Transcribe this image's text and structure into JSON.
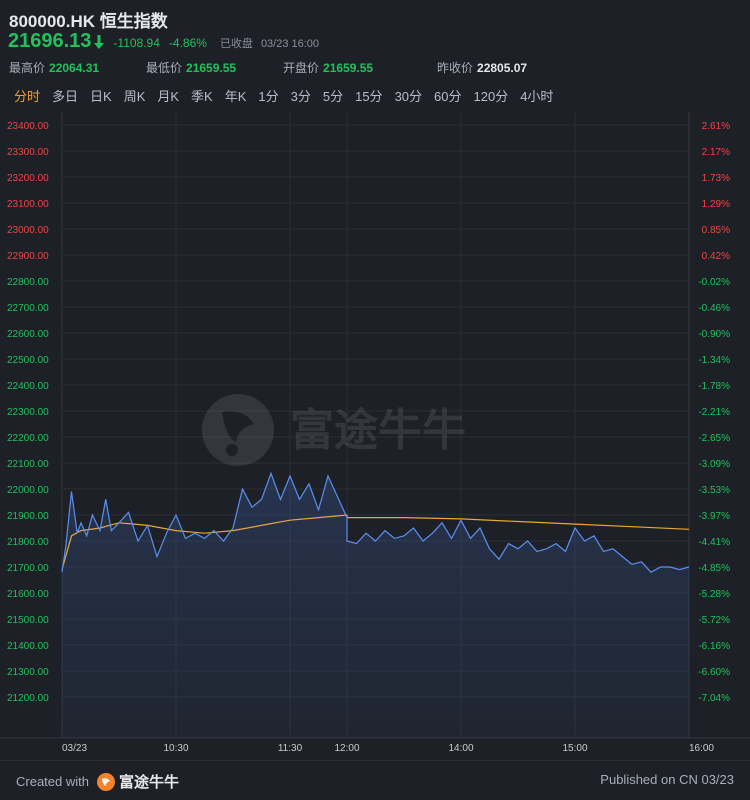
{
  "header": {
    "title": "800000.HK 恒生指数",
    "price": "21696.13",
    "change": "-1108.94",
    "change_pct": "-4.86%",
    "status": "已收盘",
    "timestamp": "03/23 16:00",
    "arrow_icon": "arrow-down-icon",
    "up_color": "#f04545",
    "down_color": "#21c25b"
  },
  "stats": [
    {
      "label": "最高价",
      "value": "22064.31"
    },
    {
      "label": "最低价",
      "value": "21659.55"
    },
    {
      "label": "开盘价",
      "value": "21659.55"
    },
    {
      "label": "昨收价",
      "value": "22805.07"
    }
  ],
  "tabs": [
    "分时",
    "多日",
    "日K",
    "周K",
    "月K",
    "季K",
    "年K",
    "1分",
    "3分",
    "5分",
    "15分",
    "30分",
    "60分",
    "120分",
    "4小时"
  ],
  "active_tab": "分时",
  "watermark": "富途牛牛",
  "footer": {
    "created_prefix": "Created with",
    "brand": "富途牛牛",
    "published": "Published on CN 03/23"
  },
  "chart_data": {
    "type": "line",
    "ylim": [
      21100,
      23450
    ],
    "prev_close": 22805.07,
    "y_ticks": [
      "23400.00",
      "23300.00",
      "23200.00",
      "23100.00",
      "23000.00",
      "22900.00",
      "22800.00",
      "22700.00",
      "22600.00",
      "22500.00",
      "22400.00",
      "22300.00",
      "22200.00",
      "22100.00",
      "22000.00",
      "21900.00",
      "21800.00",
      "21700.00",
      "21600.00",
      "21500.00",
      "21400.00",
      "21300.00",
      "21200.00"
    ],
    "y_tick_values": [
      23400,
      23300,
      23200,
      23100,
      23000,
      22900,
      22800,
      22700,
      22600,
      22500,
      22400,
      22300,
      22200,
      22100,
      22000,
      21900,
      21800,
      21700,
      21600,
      21500,
      21400,
      21300,
      21200
    ],
    "pct_ticks": [
      "2.61%",
      "2.17%",
      "1.73%",
      "1.29%",
      "0.85%",
      "0.42%",
      "-0.02%",
      "-0.46%",
      "-0.90%",
      "-1.34%",
      "-1.78%",
      "-2.21%",
      "-2.65%",
      "-3.09%",
      "-3.53%",
      "-3.97%",
      "-4.41%",
      "-4.85%",
      "-5.28%",
      "-5.72%",
      "-6.16%",
      "-6.60%",
      "-7.04%"
    ],
    "x_ticks": [
      {
        "label": "03/23",
        "x": "09:30"
      },
      {
        "label": "10:30",
        "x": "10:30"
      },
      {
        "label": "11:30",
        "x": "11:30"
      },
      {
        "label": "12:00",
        "x": "13:00"
      },
      {
        "label": "14:00",
        "x": "14:00"
      },
      {
        "label": "15:00",
        "x": "15:00"
      },
      {
        "label": "16:00",
        "x": "16:00"
      }
    ],
    "series": [
      {
        "name": "",
        "color": "#5b8ff0",
        "x": [
          "09:30",
          "09:32",
          "09:35",
          "09:38",
          "09:40",
          "09:43",
          "09:46",
          "09:50",
          "09:53",
          "09:56",
          "10:00",
          "10:05",
          "10:10",
          "10:15",
          "10:20",
          "10:25",
          "10:30",
          "10:35",
          "10:40",
          "10:45",
          "10:50",
          "10:55",
          "11:00",
          "11:05",
          "11:10",
          "11:15",
          "11:20",
          "11:25",
          "11:30",
          "11:35",
          "11:40",
          "11:45",
          "11:50",
          "11:55",
          "12:00",
          "13:00",
          "13:05",
          "13:10",
          "13:15",
          "13:20",
          "13:25",
          "13:30",
          "13:35",
          "13:40",
          "13:45",
          "13:50",
          "13:55",
          "14:00",
          "14:05",
          "14:10",
          "14:15",
          "14:20",
          "14:25",
          "14:30",
          "14:35",
          "14:40",
          "14:45",
          "14:50",
          "14:55",
          "15:00",
          "15:05",
          "15:10",
          "15:15",
          "15:20",
          "15:25",
          "15:30",
          "15:35",
          "15:40",
          "15:45",
          "15:50",
          "15:55",
          "16:00"
        ],
        "y": [
          21680,
          21780,
          21990,
          21830,
          21870,
          21820,
          21900,
          21840,
          21960,
          21840,
          21870,
          21910,
          21800,
          21860,
          21740,
          21830,
          21900,
          21810,
          21830,
          21810,
          21840,
          21800,
          21850,
          22000,
          21930,
          21960,
          22060,
          21960,
          22050,
          21960,
          22020,
          21920,
          22050,
          21970,
          21890,
          21800,
          21790,
          21830,
          21800,
          21840,
          21810,
          21820,
          21850,
          21800,
          21830,
          21870,
          21810,
          21880,
          21810,
          21850,
          21770,
          21730,
          21790,
          21770,
          21800,
          21760,
          21770,
          21790,
          21760,
          21850,
          21800,
          21820,
          21760,
          21770,
          21740,
          21710,
          21720,
          21680,
          21700,
          21700,
          21690,
          21700
        ]
      },
      {
        "name": "",
        "color": "#e8a838",
        "x": [
          "09:30",
          "09:35",
          "09:40",
          "09:50",
          "10:00",
          "10:15",
          "10:30",
          "10:45",
          "11:00",
          "11:15",
          "11:30",
          "11:45",
          "12:00",
          "13:00",
          "13:30",
          "14:00",
          "14:30",
          "15:00",
          "15:30",
          "16:00"
        ],
        "y": [
          21690,
          21820,
          21840,
          21850,
          21870,
          21860,
          21840,
          21830,
          21840,
          21860,
          21880,
          21890,
          21900,
          21890,
          21890,
          21885,
          21875,
          21865,
          21855,
          21845
        ]
      }
    ]
  }
}
